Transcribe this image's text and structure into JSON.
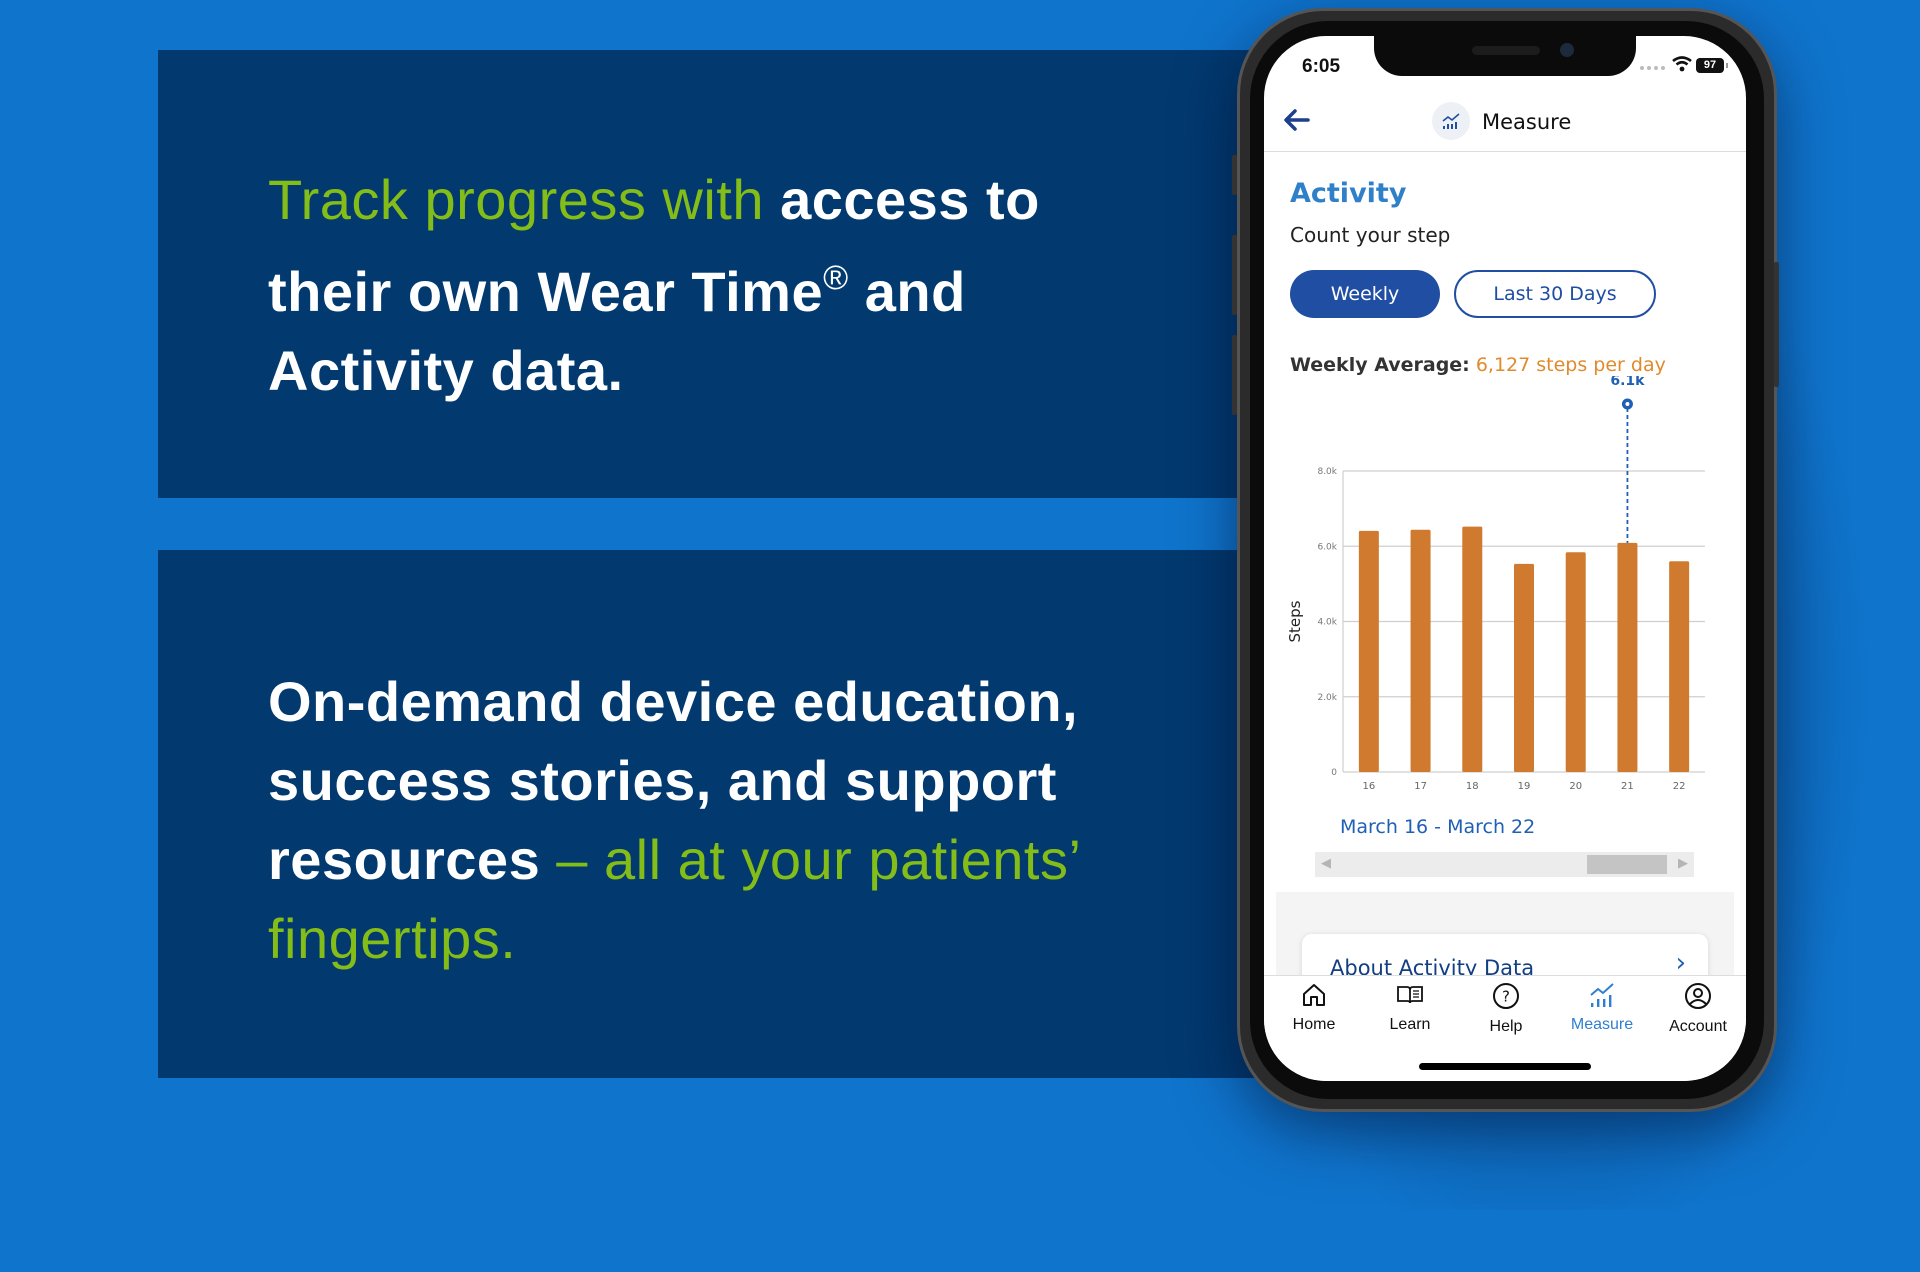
{
  "colors": {
    "background": "#0f74cc",
    "panel": "#02396f",
    "accent_green": "#84bd18",
    "primary_blue": "#1f4ea3",
    "bar_orange": "#cf7a2e",
    "average_orange": "#e08a2c",
    "title_blue": "#2f80c9"
  },
  "panels": [
    {
      "green_text": "Track progress with",
      "white_text_1": "access to their own Wear Time",
      "registered": "®",
      "white_text_2": "and Activity data."
    },
    {
      "white_text": "On-demand device education, success stories, and support resources",
      "green_text": "– all at your patients’ fingertips."
    }
  ],
  "phone": {
    "status_bar": {
      "time": "6:05",
      "battery": "97",
      "wifi_icon": "wifi-icon"
    },
    "header": {
      "back_icon": "arrow-left-icon",
      "title_icon": "chart-icon",
      "title": "Measure"
    },
    "section": {
      "title": "Activity",
      "subtitle": "Count your step"
    },
    "period_buttons": [
      {
        "label": "Weekly",
        "selected": true
      },
      {
        "label": "Last 30 Days",
        "selected": false
      }
    ],
    "average": {
      "label": "Weekly Average:",
      "value": "6,127 steps per day"
    },
    "date_range": "March 16 - March 22",
    "card": {
      "title": "About Activity Data",
      "chevron_icon": "chevron-right-icon"
    },
    "tabs": [
      {
        "label": "Home",
        "icon": "home-icon",
        "active": false
      },
      {
        "label": "Learn",
        "icon": "book-icon",
        "active": false
      },
      {
        "label": "Help",
        "icon": "help-icon",
        "active": false
      },
      {
        "label": "Measure",
        "icon": "chart-icon",
        "active": true
      },
      {
        "label": "Account",
        "icon": "account-icon",
        "active": false
      }
    ]
  },
  "chart_data": {
    "type": "bar",
    "title": "",
    "xlabel": "",
    "ylabel": "Steps",
    "categories": [
      "16",
      "17",
      "18",
      "19",
      "20",
      "21",
      "22"
    ],
    "values": [
      6410,
      6440,
      6520,
      5530,
      5840,
      6090,
      5600
    ],
    "ylim": [
      0,
      8000
    ],
    "yticks": [
      0,
      2000,
      4000,
      6000,
      8000
    ],
    "ytick_labels": [
      "0",
      "2.0k",
      "4.0k",
      "6.0k",
      "8.0k"
    ],
    "grid": true,
    "annotation": {
      "category": "21",
      "label": "6.1k"
    }
  }
}
